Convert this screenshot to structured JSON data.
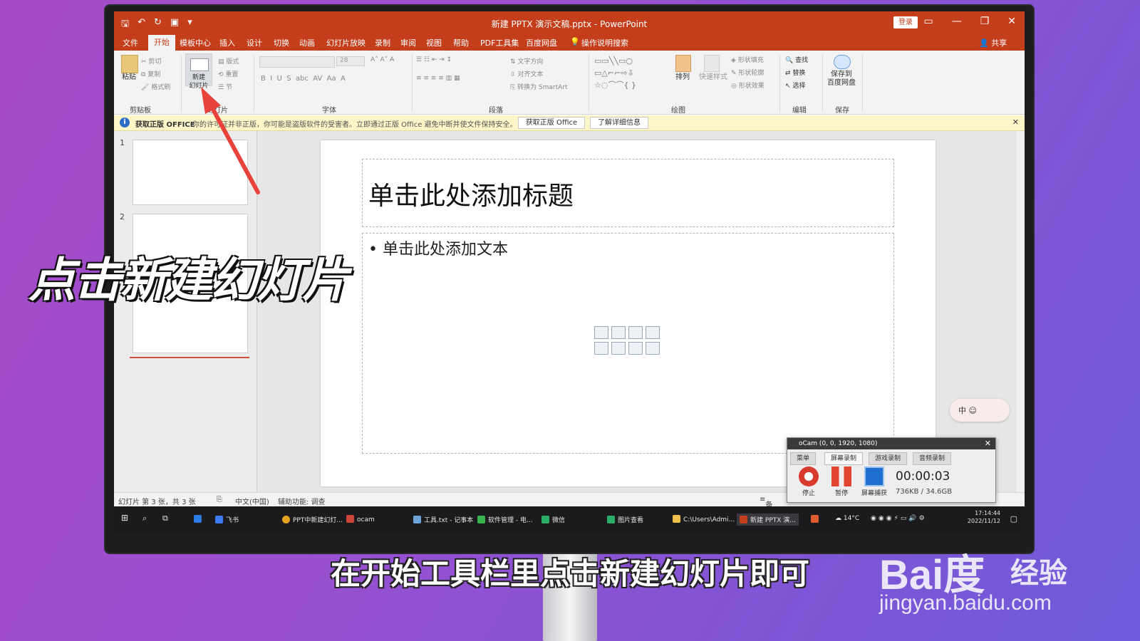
{
  "window": {
    "title": "新建 PPTX 演示文稿.pptx - PowerPoint",
    "login": "登录",
    "share": "共享",
    "controls": [
      "—",
      "❐",
      "✕"
    ]
  },
  "menu": [
    {
      "label": "文件"
    },
    {
      "label": "开始",
      "active": true
    },
    {
      "label": "模板中心"
    },
    {
      "label": "插入"
    },
    {
      "label": "设计"
    },
    {
      "label": "切换"
    },
    {
      "label": "动画"
    },
    {
      "label": "幻灯片放映"
    },
    {
      "label": "录制"
    },
    {
      "label": "审阅"
    },
    {
      "label": "视图"
    },
    {
      "label": "帮助"
    },
    {
      "label": "PDF工具集"
    },
    {
      "label": "百度网盘"
    },
    {
      "label": "操作说明搜索"
    }
  ],
  "ribbon": {
    "groups": [
      "剪贴板",
      "幻灯片",
      "字体",
      "段落",
      "绘图",
      "编辑",
      "保存"
    ],
    "clipboard": {
      "paste": "粘贴",
      "cut": "剪切",
      "copy": "复制",
      "format": "格式刷"
    },
    "slides": {
      "new_slide": "新建\n幻灯片",
      "layout": "版式",
      "reset": "重置",
      "section": "节"
    },
    "font": {
      "size": "28"
    },
    "paragraph": {
      "text_dir": "文字方向",
      "align_text": "对齐文本",
      "smartart": "转换为 SmartArt"
    },
    "drawing": {
      "arrange": "排列",
      "quick_styles": "快速样式",
      "fill": "形状填充",
      "outline": "形状轮廓",
      "effects": "形状效果"
    },
    "editing": {
      "find": "查找",
      "replace": "替换",
      "select": "选择"
    },
    "save": {
      "save_to": "保存到\n百度网盘"
    }
  },
  "notice": {
    "title": "获取正版 OFFICE",
    "text": "你的许可证并非正版，你可能是盗版软件的受害者。立即通过正版 Office 避免中断并使文件保持安全。",
    "btn_get": "获取正版 Office",
    "btn_more": "了解详细信息"
  },
  "thumbnails": [
    {
      "num": "1"
    },
    {
      "num": "2"
    }
  ],
  "slide": {
    "title_placeholder": "单击此处添加标题",
    "body_placeholder": "• 单击此处添加文本"
  },
  "ime": "中 ☺",
  "status": {
    "slide_count": "幻灯片 第 3 张，共 3 张",
    "language": "中文(中国)",
    "accessibility": "辅助功能: 调查",
    "notes": "备注"
  },
  "taskbar": {
    "items": [
      "飞书",
      "PPT中新建幻灯...",
      "ocam",
      "工具.txt - 记事本",
      "软件管理 - 电...",
      "微信",
      "图片查看",
      "C:\\Users\\Admi...",
      "新建 PPTX 演..."
    ],
    "weather": "14°C",
    "time": "17:14:44",
    "date": "2022/11/12"
  },
  "ocam": {
    "title": "oCam (0, 0, 1920, 1080)",
    "tabs": [
      "菜单",
      "屏幕录制",
      "游戏录制",
      "音频录制"
    ],
    "stop": "停止",
    "pause": "暂停",
    "capture": "屏幕捕获",
    "timer": "00:00:03",
    "size": "736KB / 34.6GB"
  },
  "overlay": {
    "caption": "点击新建幻灯片",
    "subtitle": "在开始工具栏里点击新建幻灯片即可",
    "watermark_logo": "Bai度",
    "watermark_cn": "经验",
    "watermark_url": "jingyan.baidu.com"
  },
  "colors": {
    "accent": "#c43e1c",
    "background": "#9a4fcf",
    "arrow": "#e8423a"
  }
}
